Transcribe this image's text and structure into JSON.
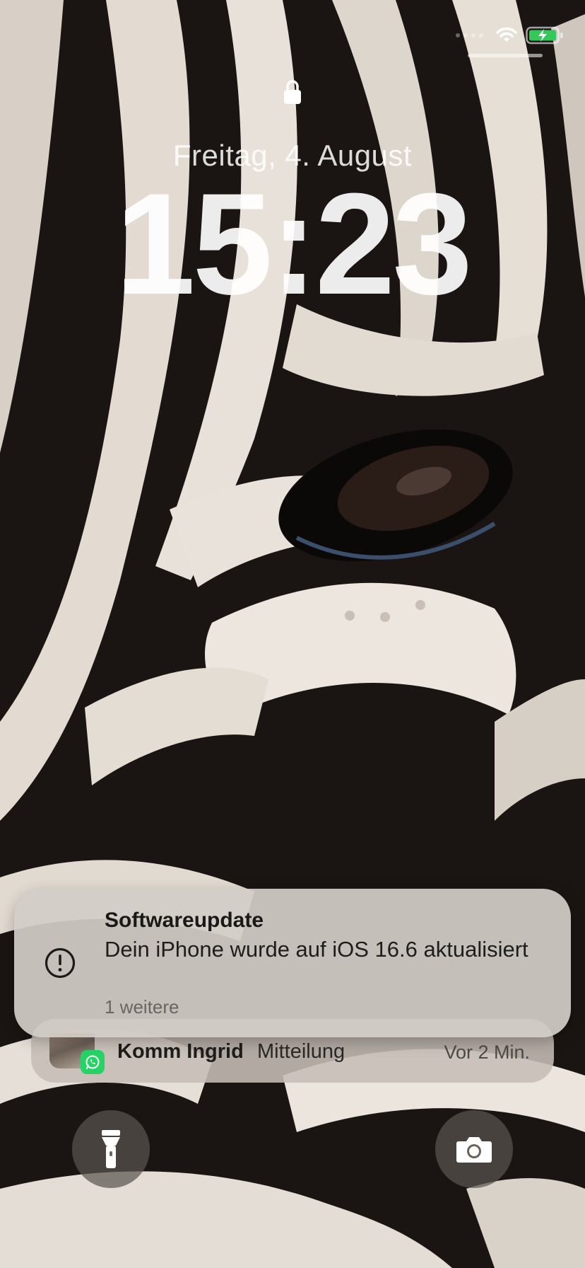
{
  "lock_screen": {
    "date": "Freitag, 4. August",
    "time": "15:23"
  },
  "status_bar": {
    "wifi_icon": "wifi-icon",
    "battery_icon": "battery-charging-icon",
    "battery_color": "#34c759"
  },
  "notifications": {
    "front": {
      "icon": "exclamation-circle-icon",
      "title": "Softwareupdate",
      "body": "Dein iPhone wurde auf iOS 16.6 aktualisiert",
      "more": "1 weitere"
    },
    "back": {
      "app_icon": "whatsapp-icon",
      "sender": "Komm Ingrid",
      "text": "Mitteilung",
      "time": "Vor 2 Min."
    }
  },
  "quick_actions": {
    "flashlight_icon": "flashlight-icon",
    "camera_icon": "camera-icon"
  }
}
